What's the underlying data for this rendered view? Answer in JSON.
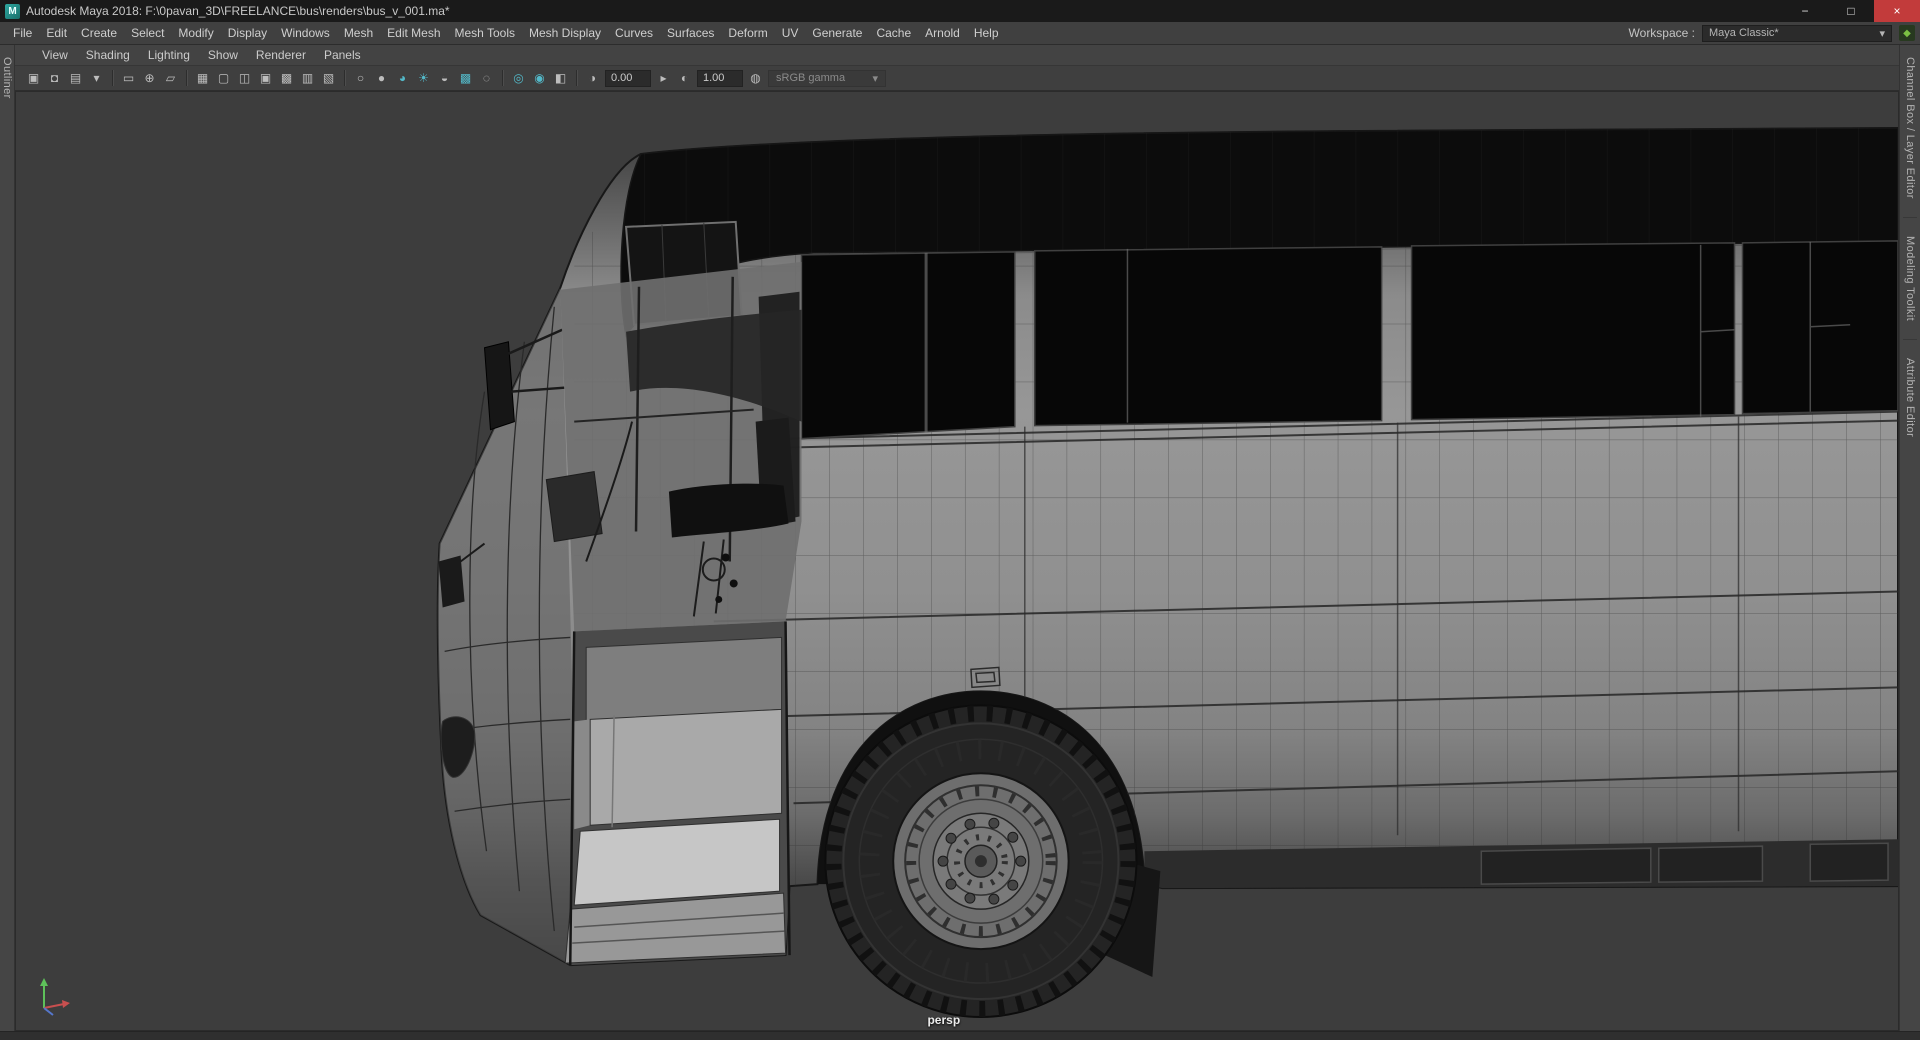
{
  "window": {
    "title": "Autodesk Maya 2018: F:\\0pavan_3D\\FREELANCE\\bus\\renders\\bus_v_001.ma*",
    "app_icon": "M",
    "controls": {
      "minimize": "−",
      "maximize": "□",
      "close": "×"
    }
  },
  "menubar": {
    "items": [
      {
        "label": "File"
      },
      {
        "label": "Edit"
      },
      {
        "label": "Create"
      },
      {
        "label": "Select"
      },
      {
        "label": "Modify"
      },
      {
        "label": "Display"
      },
      {
        "label": "Windows"
      },
      {
        "label": "Mesh"
      },
      {
        "label": "Edit Mesh"
      },
      {
        "label": "Mesh Tools"
      },
      {
        "label": "Mesh Display"
      },
      {
        "label": "Curves"
      },
      {
        "label": "Surfaces"
      },
      {
        "label": "Deform"
      },
      {
        "label": "UV"
      },
      {
        "label": "Generate"
      },
      {
        "label": "Cache"
      },
      {
        "label": "Arnold"
      },
      {
        "label": "Help"
      }
    ],
    "workspace_label": "Workspace :",
    "workspace_value": "Maya Classic*",
    "dropdown_arrow": "▾",
    "workspace_pin_glyph": "◆"
  },
  "panel_menu": {
    "items": [
      "View",
      "Shading",
      "Lighting",
      "Show",
      "Renderer",
      "Panels"
    ]
  },
  "toolbar": {
    "icons": [
      {
        "name": "select-camera-icon",
        "glyph": "▣",
        "active": false
      },
      {
        "name": "lock-camera-icon",
        "glyph": "◘",
        "active": false
      },
      {
        "name": "camera-attributes-icon",
        "glyph": "▤",
        "active": false
      },
      {
        "name": "bookmarks-icon",
        "glyph": "▾",
        "active": false
      },
      {
        "name": "image-plane-icon",
        "glyph": "▭",
        "active": false
      },
      {
        "name": "pan-zoom-icon",
        "glyph": "⊕",
        "active": false
      },
      {
        "name": "grease-pencil-icon",
        "glyph": "▱",
        "active": false
      },
      {
        "name": "grid-icon",
        "glyph": "▦",
        "active": false
      },
      {
        "name": "film-gate-icon",
        "glyph": "▢",
        "active": false
      },
      {
        "name": "resolution-gate-icon",
        "glyph": "◫",
        "active": false
      },
      {
        "name": "gate-mask-icon",
        "glyph": "▣",
        "active": false
      },
      {
        "name": "field-chart-icon",
        "glyph": "▩",
        "active": false
      },
      {
        "name": "safe-action-icon",
        "glyph": "▥",
        "active": false
      },
      {
        "name": "safe-title-icon",
        "glyph": "▧",
        "active": false
      },
      {
        "name": "wireframe-icon",
        "glyph": "○",
        "active": false
      },
      {
        "name": "shaded-icon",
        "glyph": "●",
        "active": false
      },
      {
        "name": "textured-icon",
        "glyph": "◕",
        "active": true
      },
      {
        "name": "use-all-lights-icon",
        "glyph": "☀",
        "active": true
      },
      {
        "name": "shadows-icon",
        "glyph": "◒",
        "active": false
      },
      {
        "name": "ao-icon",
        "glyph": "▩",
        "active": true
      },
      {
        "name": "motion-blur-icon",
        "glyph": "◌",
        "active": false
      },
      {
        "name": "antialiasing-icon",
        "glyph": "◎",
        "active": true
      },
      {
        "name": "depth-of-field-icon",
        "glyph": "◉",
        "active": true
      },
      {
        "name": "isolate-select-icon",
        "glyph": "◧",
        "active": false
      }
    ],
    "exposure_icon": "◑",
    "exposure": "0.00",
    "gamma_arrow_icon": "▸",
    "gamma_icon": "◐",
    "gamma": "1.00",
    "view_transform_icon": "◍",
    "view_transform": "sRGB gamma",
    "dropdown_arrow": "▾"
  },
  "sidebar_left": {
    "tabs": [
      "Outliner"
    ]
  },
  "sidebar_right": {
    "tabs": [
      "Channel Box / Layer Editor",
      "Modeling Toolkit",
      "Attribute Editor"
    ]
  },
  "viewport": {
    "camera": "persp"
  },
  "colors": {
    "titlebar_bg": "#1a1a1a",
    "menubar_bg": "#404040",
    "panel_bg": "#434343",
    "toolbar_bg": "#3f3f3f",
    "viewport_bg": "#3d3d3d",
    "field_bg": "#2b2b2b",
    "text": "#cccccc",
    "accent_teal": "#53b9c9",
    "close_red": "#c23b3b",
    "axis_green": "#5ec15a",
    "axis_red": "#c84f4f",
    "axis_blue": "#5577cc"
  }
}
